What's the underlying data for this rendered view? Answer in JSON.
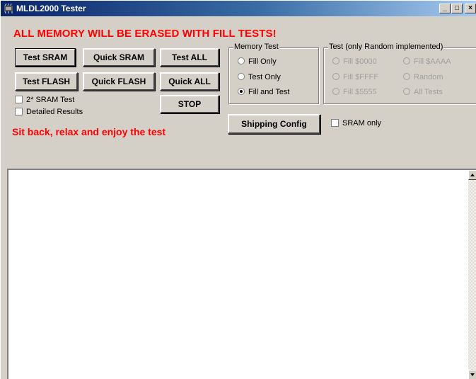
{
  "window": {
    "title": "MLDL2000 Tester",
    "minimize": "_",
    "maximize": "□",
    "close": "×"
  },
  "warning": "ALL MEMORY WILL BE ERASED WITH FILL TESTS!",
  "buttons": {
    "test_sram": "Test SRAM",
    "quick_sram": "Quick SRAM",
    "test_all": "Test ALL",
    "test_flash": "Test FLASH",
    "quick_flash": "Quick FLASH",
    "quick_all": "Quick ALL",
    "stop": "STOP",
    "shipping_config": "Shipping Config"
  },
  "options": {
    "sram2x": {
      "label": "2* SRAM Test",
      "checked": false
    },
    "detailed": {
      "label": "Detailed Results",
      "checked": false
    },
    "sram_only": {
      "label": "SRAM only",
      "checked": false
    }
  },
  "status_message": "Sit back, relax and enjoy the test",
  "memory_test": {
    "title": "Memory Test",
    "options": [
      "Fill Only",
      "Test Only",
      "Fill and Test"
    ],
    "selected": "Fill and Test"
  },
  "test_pattern": {
    "title": "Test (only Random implemented)",
    "options": [
      "Fill $0000",
      "Fill $AAAA",
      "Fill $FFFF",
      "Random",
      "Fill $5555",
      "All Tests"
    ]
  },
  "log": {
    "text": ""
  }
}
